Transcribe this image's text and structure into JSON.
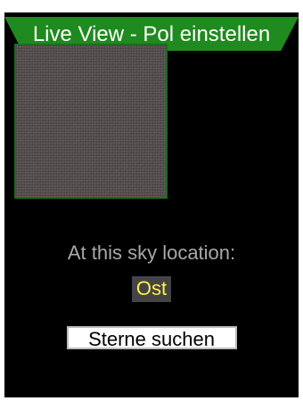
{
  "header": {
    "title": "Live View - Pol einstellen"
  },
  "preview": {
    "icon": "live-view-image"
  },
  "location": {
    "label": "At this sky location:",
    "direction": "Ost"
  },
  "actions": {
    "search_label": "Sterne suchen"
  },
  "colors": {
    "title_bar": "#1f8a1f",
    "direction_text": "#ffef4a",
    "direction_bg": "#444444",
    "label_text": "#a8a8a8"
  }
}
